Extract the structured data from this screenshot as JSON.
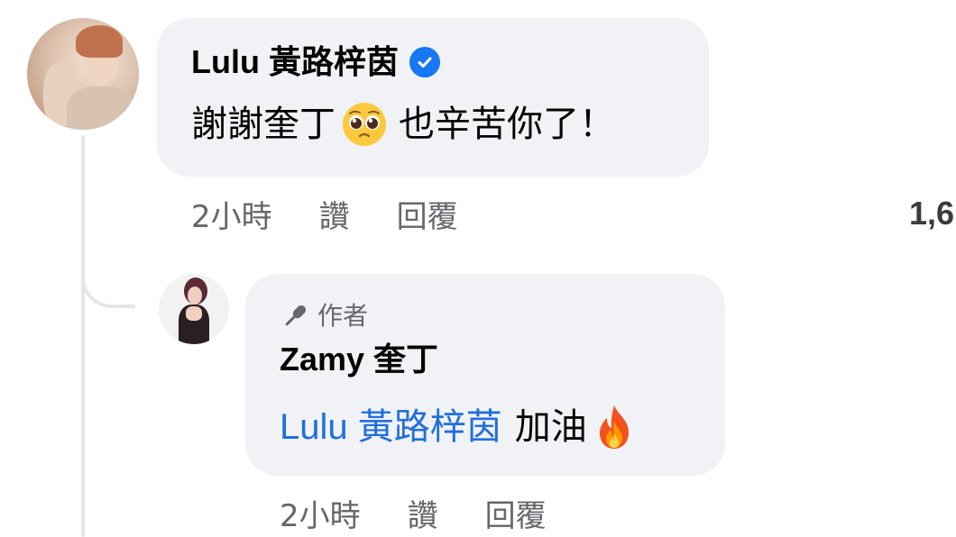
{
  "comment": {
    "author": "Lulu 黃路梓茵",
    "verified_icon": "verified-badge-icon",
    "text_before_emoji": "謝謝奎丁",
    "emoji": "pleading-face",
    "text_after_emoji": "也辛苦你了！",
    "time": "2小時",
    "like_label": "讚",
    "reply_label": "回覆",
    "reaction_count": "1,6"
  },
  "reply": {
    "badge_icon": "microphone-icon",
    "badge_label": "作者",
    "author": "Zamy 奎丁",
    "mention": "Lulu 黃路梓茵",
    "text": "加油",
    "emoji": "fire",
    "time": "2小時",
    "like_label": "讚",
    "reply_label": "回覆"
  },
  "colors": {
    "bubble": "#f0f2f5",
    "mention": "#216fdb",
    "meta_text": "#65676b",
    "verified": "#1877f2",
    "thread_line": "#e4e6eb"
  }
}
